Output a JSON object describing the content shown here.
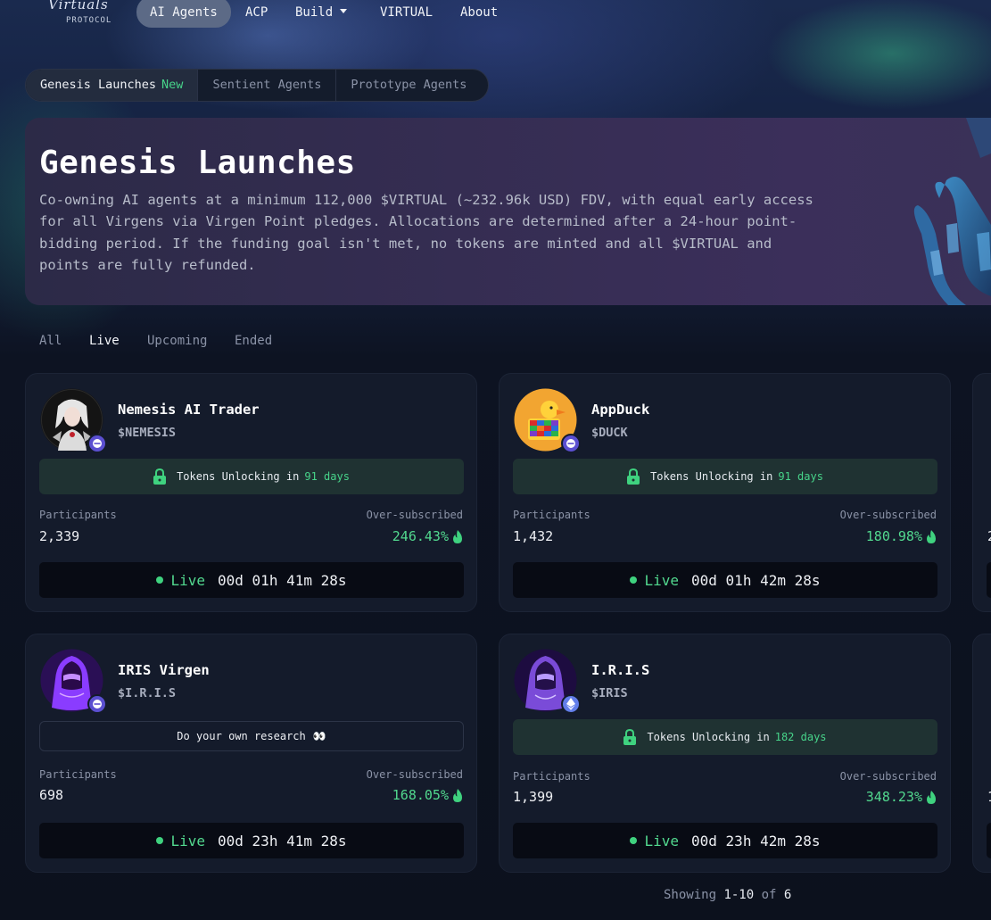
{
  "nav": {
    "logo_text": "Virtuals",
    "logo_sub": "PROTOCOL",
    "items": [
      {
        "label": "AI Agents"
      },
      {
        "label": "ACP"
      },
      {
        "label": "Build"
      },
      {
        "label": "VIRTUAL"
      },
      {
        "label": "About"
      }
    ]
  },
  "category_tabs": [
    {
      "label": "Genesis Launches",
      "badge": "New"
    },
    {
      "label": "Sentient Agents"
    },
    {
      "label": "Prototype Agents"
    }
  ],
  "hero": {
    "title": "Genesis Launches",
    "description": "Co-owning AI agents at a minimum 112,000 $VIRTUAL (~232.96k USD) FDV, with equal early access for all Virgens via Virgen Point pledges. Allocations are determined after a 24-hour point-bidding period. If the funding goal isn't met, no tokens are minted and all $VIRTUAL and points are fully refunded."
  },
  "filters": [
    "All",
    "Live",
    "Upcoming",
    "Ended"
  ],
  "active_filter": "Live",
  "labels": {
    "participants": "Participants",
    "oversubscribed": "Over-subscribed",
    "tokens_unlocking": "Tokens Unlocking in",
    "live": "Live"
  },
  "cards": [
    {
      "name": "Nemesis AI Trader",
      "ticker": "$NEMESIS",
      "unlock_days": "91 days",
      "participants": "2,339",
      "oversubscribed": "246.43%",
      "countdown": "00d 01h 41m 28s",
      "chain_icon": "base-chain-icon"
    },
    {
      "name": "AppDuck",
      "ticker": "$DUCK",
      "unlock_days": "91 days",
      "participants": "1,432",
      "oversubscribed": "180.98%",
      "countdown": "00d 01h 42m 28s",
      "chain_icon": "base-chain-icon"
    },
    {
      "name": "IRIS Virgen",
      "ticker": "$I.R.I.S",
      "notice": "Do your own research",
      "notice_emoji": "👀",
      "participants": "698",
      "oversubscribed": "168.05%",
      "countdown": "00d 23h 41m 28s",
      "chain_icon": "base-chain-icon"
    },
    {
      "name": "I.R.I.S",
      "ticker": "$IRIS",
      "unlock_days": "182 days",
      "participants": "1,399",
      "oversubscribed": "348.23%",
      "countdown": "00d 23h 42m 28s",
      "chain_icon": "ethereum-chain-icon"
    }
  ],
  "peek_cards": [
    {
      "participants_partial": "2"
    },
    {
      "participants_partial": "1"
    }
  ],
  "pagination": {
    "prefix": "Showing",
    "range": "1-10",
    "of": "of",
    "total": "6"
  },
  "colors": {
    "accent_green": "#52d98f",
    "background": "#0c111d",
    "card": "#141b2b",
    "unlock_bar": "#1f3232"
  }
}
